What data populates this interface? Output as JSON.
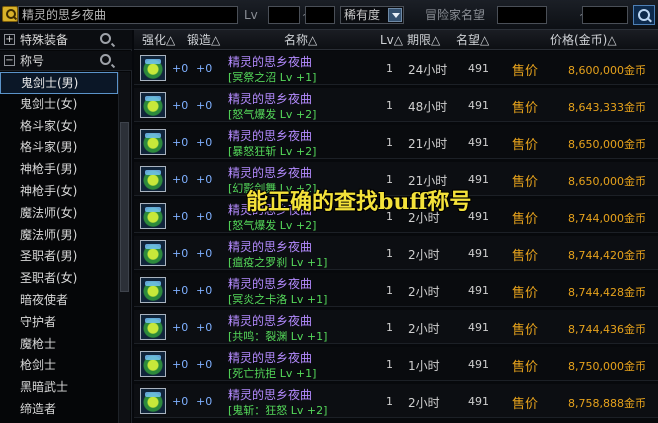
{
  "search": {
    "item_name": "精灵的思乡夜曲",
    "lv_label": "Lv",
    "lv_min": "",
    "lv_max": "",
    "range_sep": "~",
    "rarity": "稀有度",
    "adventurer_placeholder": "冒险家名望",
    "fame_min": "",
    "fame_max": ""
  },
  "sidebar": {
    "special_equipment": "特殊装备",
    "title_category": "称号",
    "classes": [
      "鬼剑士(男)",
      "鬼剑士(女)",
      "格斗家(女)",
      "格斗家(男)",
      "神枪手(男)",
      "神枪手(女)",
      "魔法师(女)",
      "魔法师(男)",
      "圣职者(男)",
      "圣职者(女)",
      "暗夜使者",
      "守护者",
      "魔枪士",
      "枪剑士",
      "黑暗武士",
      "缔造者"
    ],
    "selected": 0
  },
  "table": {
    "headers": {
      "strength": "强化△",
      "forge": "锻造△",
      "name": "名称△",
      "lv": "Lv△",
      "period": "期限△",
      "fame": "名望△",
      "price": "价格(金币)△"
    },
    "rows": [
      {
        "strength": "+0",
        "forge": "+0",
        "name": "精灵的思乡夜曲",
        "sub": "[冥祭之沼 Lv +1]",
        "lv": "1",
        "period": "24小时",
        "fame": "491",
        "price_label": "售价",
        "price": "8,600,000金币"
      },
      {
        "strength": "+0",
        "forge": "+0",
        "name": "精灵的思乡夜曲",
        "sub": "[怒气爆发 Lv +2]",
        "lv": "1",
        "period": "48小时",
        "fame": "491",
        "price_label": "售价",
        "price": "8,643,333金币"
      },
      {
        "strength": "+0",
        "forge": "+0",
        "name": "精灵的思乡夜曲",
        "sub": "[暴怒狂斩 Lv +2]",
        "lv": "1",
        "period": "21小时",
        "fame": "491",
        "price_label": "售价",
        "price": "8,650,000金币"
      },
      {
        "strength": "+0",
        "forge": "+0",
        "name": "精灵的思乡夜曲",
        "sub": "[幻影剑舞 Lv +2]",
        "lv": "1",
        "period": "21小时",
        "fame": "491",
        "price_label": "售价",
        "price": "8,650,000金币"
      },
      {
        "strength": "+0",
        "forge": "+0",
        "name": "精灵的思乡夜曲",
        "sub": "[怒气爆发 Lv +2]",
        "lv": "1",
        "period": "2小时",
        "fame": "491",
        "price_label": "售价",
        "price": "8,744,000金币"
      },
      {
        "strength": "+0",
        "forge": "+0",
        "name": "精灵的思乡夜曲",
        "sub": "[瘟疫之罗刹 Lv +1]",
        "lv": "1",
        "period": "2小时",
        "fame": "491",
        "price_label": "售价",
        "price": "8,744,420金币"
      },
      {
        "strength": "+0",
        "forge": "+0",
        "name": "精灵的思乡夜曲",
        "sub": "[冥炎之卡洛 Lv +1]",
        "lv": "1",
        "period": "2小时",
        "fame": "491",
        "price_label": "售价",
        "price": "8,744,428金币"
      },
      {
        "strength": "+0",
        "forge": "+0",
        "name": "精灵的思乡夜曲",
        "sub": "[共鸣：裂渊 Lv +1]",
        "lv": "1",
        "period": "2小时",
        "fame": "491",
        "price_label": "售价",
        "price": "8,744,436金币"
      },
      {
        "strength": "+0",
        "forge": "+0",
        "name": "精灵的思乡夜曲",
        "sub": "[死亡抗拒 Lv +1]",
        "lv": "1",
        "period": "1小时",
        "fame": "491",
        "price_label": "售价",
        "price": "8,750,000金币"
      },
      {
        "strength": "+0",
        "forge": "+0",
        "name": "精灵的思乡夜曲",
        "sub": "[鬼斩：狂怒 Lv +2]",
        "lv": "1",
        "period": "2小时",
        "fame": "491",
        "price_label": "售价",
        "price": "8,758,888金币"
      }
    ]
  },
  "overlay_caption": "能正确的查找buff称号",
  "colors": {
    "name": "#b48bff",
    "sub": "#55d95a",
    "price": "#e6a21c",
    "enhance": "#7fb0ff",
    "caption": "#f4e23a"
  }
}
